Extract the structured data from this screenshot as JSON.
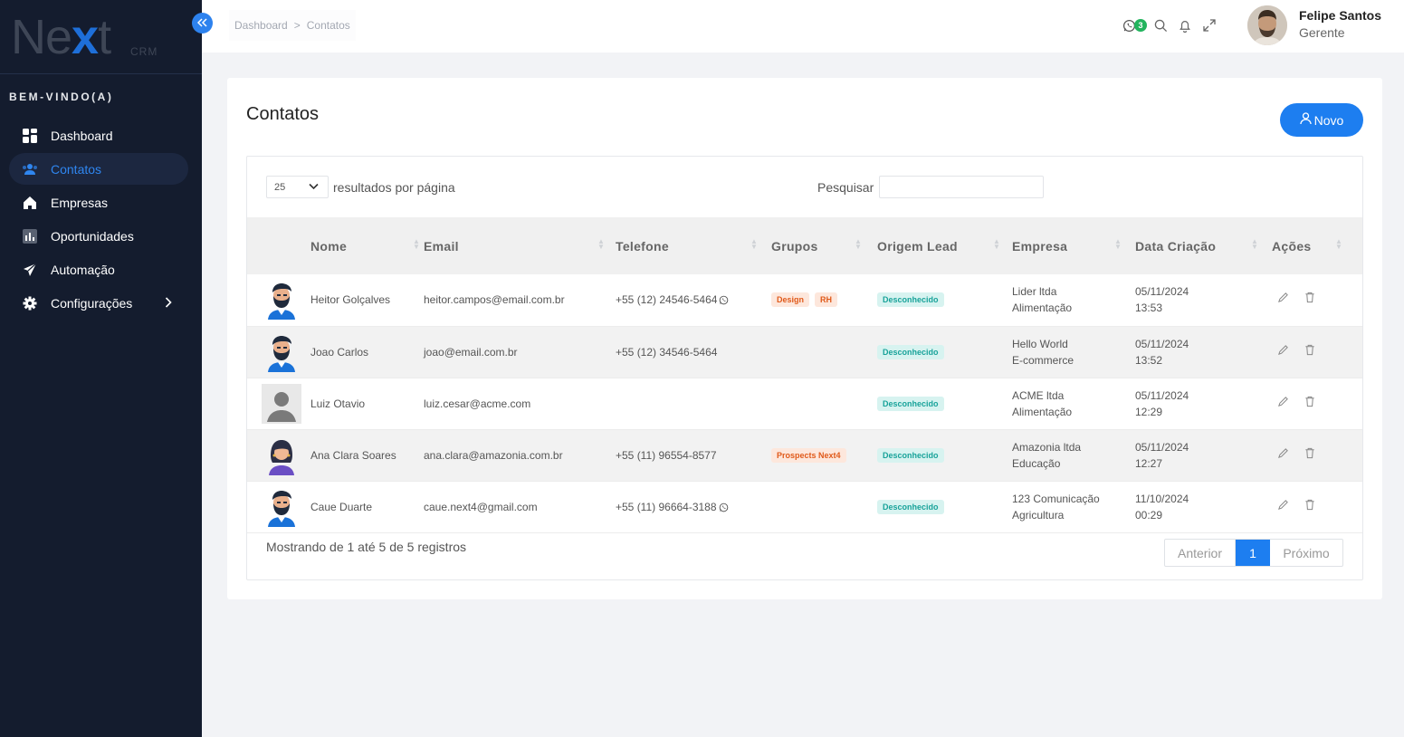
{
  "brand": {
    "logo_main_n": "N",
    "logo_main_e": "e",
    "logo_main_x": "x",
    "logo_main_t": "t",
    "logo_sub": "CRM"
  },
  "sidebar": {
    "welcome": "BEM-VINDO(A)",
    "items": [
      {
        "label": "Dashboard",
        "icon": "dashboard-icon"
      },
      {
        "label": "Contatos",
        "icon": "users-icon",
        "active": true
      },
      {
        "label": "Empresas",
        "icon": "home-icon"
      },
      {
        "label": "Oportunidades",
        "icon": "chart-icon"
      },
      {
        "label": "Automação",
        "icon": "send-icon"
      },
      {
        "label": "Configurações",
        "icon": "gear-icon",
        "has_submenu": true
      }
    ]
  },
  "topbar": {
    "breadcrumb": [
      "Dashboard",
      "Contatos"
    ],
    "breadcrumb_sep": ">",
    "whatsapp_count": "3",
    "user_name": "Felipe Santos",
    "user_role": "Gerente"
  },
  "page": {
    "title": "Contatos",
    "new_button": "Novo",
    "page_length": "25",
    "page_length_label": "resultados por página",
    "search_label": "Pesquisar",
    "search_value": ""
  },
  "table": {
    "columns": [
      "Nome",
      "Email",
      "Telefone",
      "Grupos",
      "Origem Lead",
      "Empresa",
      "Data Criação",
      "Ações"
    ],
    "rows": [
      {
        "avatar": "man-beard",
        "name": "Heitor Golçalves",
        "email": "heitor.campos@email.com.br",
        "phone": "+55 (12) 24546-5464",
        "whatsapp": true,
        "groups": [
          "Design",
          "RH"
        ],
        "origin": "Desconhecido",
        "company": "Lider ltda",
        "segment": "Alimentação",
        "date": "05/11/2024",
        "time": "13:53"
      },
      {
        "avatar": "man-beard",
        "name": "Joao Carlos",
        "email": "joao@email.com.br",
        "phone": "+55 (12) 34546-5464",
        "whatsapp": false,
        "groups": [],
        "origin": "Desconhecido",
        "company": "Hello World",
        "segment": "E-commerce",
        "date": "05/11/2024",
        "time": "13:52"
      },
      {
        "avatar": "placeholder",
        "name": "Luiz Otavio",
        "email": "luiz.cesar@acme.com",
        "phone": "",
        "whatsapp": false,
        "groups": [],
        "origin": "Desconhecido",
        "company": "ACME ltda",
        "segment": "Alimentação",
        "date": "05/11/2024",
        "time": "12:29"
      },
      {
        "avatar": "woman",
        "name": "Ana Clara Soares",
        "email": "ana.clara@amazonia.com.br",
        "phone": "+55 (11) 96554-8577",
        "whatsapp": false,
        "groups": [
          "Prospects Next4"
        ],
        "origin": "Desconhecido",
        "company": "Amazonia ltda",
        "segment": "Educação",
        "date": "05/11/2024",
        "time": "12:27"
      },
      {
        "avatar": "man-beard",
        "name": "Caue Duarte",
        "email": "caue.next4@gmail.com",
        "phone": "+55 (11) 96664-3188",
        "whatsapp": true,
        "groups": [],
        "origin": "Desconhecido",
        "company": "123 Comunicação",
        "segment": "Agricultura",
        "date": "11/10/2024",
        "time": "00:29"
      }
    ]
  },
  "footer": {
    "showing": "Mostrando de 1 até 5 de 5 registros",
    "prev": "Anterior",
    "current_page": "1",
    "next": "Próximo"
  },
  "colors": {
    "sidebar_bg": "#141c2e",
    "accent": "#1d7ef0",
    "active_nav": "#2f86f0",
    "tag_orange": "#e05a1a",
    "tag_teal": "#19a39a",
    "whatsapp": "#23b45e"
  }
}
